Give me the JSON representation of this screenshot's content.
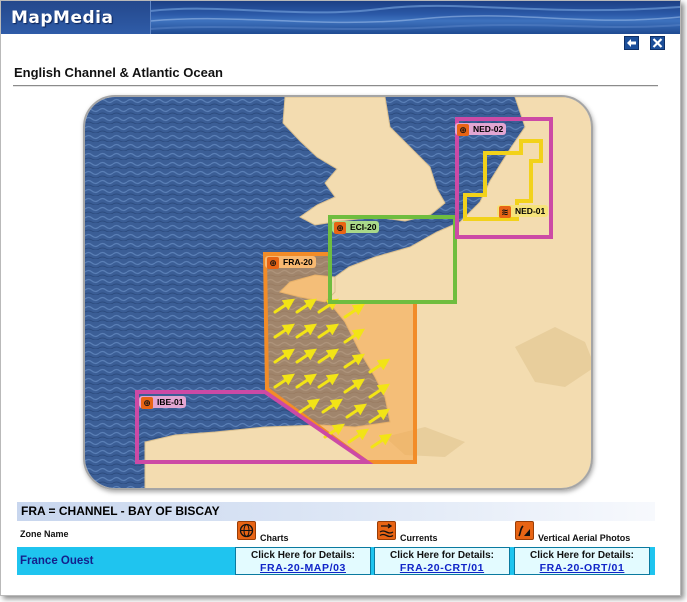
{
  "app": {
    "logo_text": "MapMedia"
  },
  "toolbar": {
    "back_icon": "arrow-left-icon",
    "close_icon": "close-icon"
  },
  "page": {
    "title": "English Channel & Atlantic Ocean"
  },
  "map": {
    "zones": [
      {
        "label": "NED-02",
        "color": "#cc4aa5",
        "icon": "globe-icon"
      },
      {
        "label": "NED-01",
        "color": "#f2d21a",
        "icon": "current-waves-icon"
      },
      {
        "label": "ECI-20",
        "color": "#6fbd3f",
        "icon": "globe-icon"
      },
      {
        "label": "FRA-20",
        "color": "#f28c28",
        "icon": "globe-icon"
      },
      {
        "label": "IBE-01",
        "color": "#cc4aa5",
        "icon": "globe-icon"
      }
    ],
    "colors": {
      "sea": "#3b5e96",
      "land": "#f3dcb0",
      "current_arrow": "#f2e416"
    }
  },
  "details": {
    "heading": "FRA = CHANNEL - BAY OF BISCAY",
    "columns": {
      "zone_name": "Zone Name",
      "charts": "Charts",
      "currents": "Currents",
      "aerial": "Vertical Aerial Photos"
    },
    "row": {
      "zone_name": "France Ouest",
      "charts_prompt": "Click Here for Details:",
      "charts_link": "FRA-20-MAP/03",
      "currents_prompt": "Click Here for Details:",
      "currents_link": "FRA-20-CRT/01",
      "aerial_prompt": "Click Here for Details:",
      "aerial_link": "FRA-20-ORT/01"
    },
    "colors": {
      "row_bg": "#1fc4ef",
      "link": "#1024c8",
      "zone_name": "#14208c"
    }
  }
}
